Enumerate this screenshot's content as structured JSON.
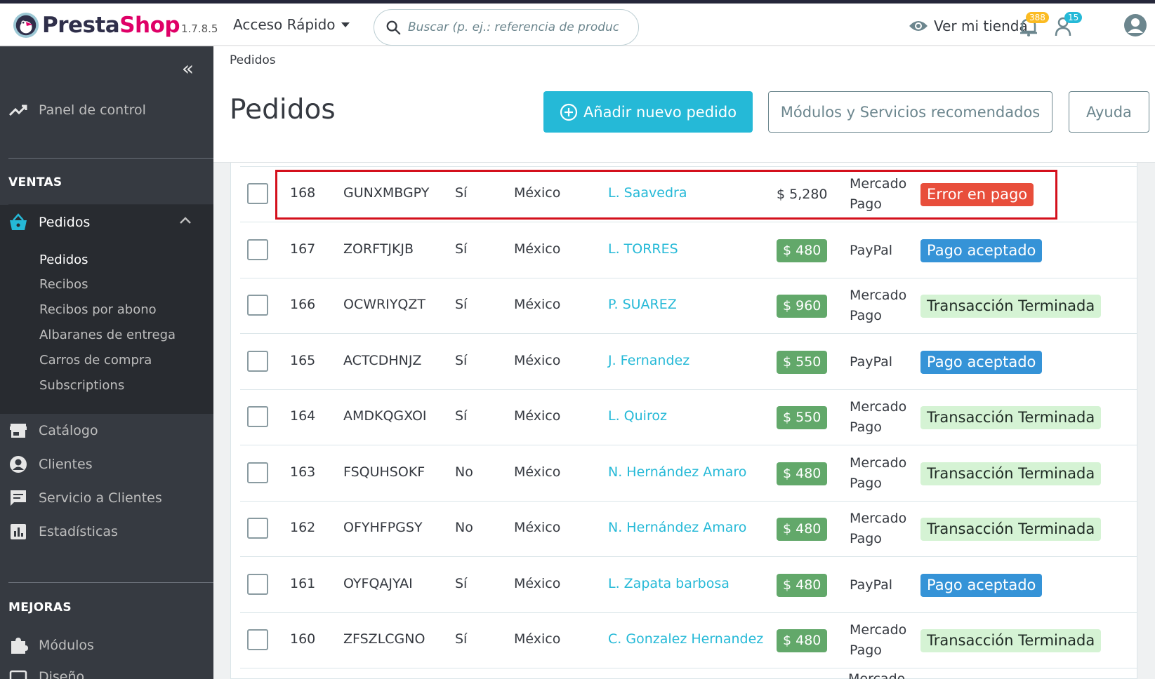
{
  "header": {
    "logo_part1": "Presta",
    "logo_part2": "Shop",
    "version": "1.7.8.5",
    "quick_access": "Acceso Rápido",
    "search_placeholder": "Buscar (p. ej.: referencia de producto, nombre de cliente…)",
    "view_store": "Ver mi tienda",
    "orders_badge": "388",
    "customers_badge": "15"
  },
  "sidebar": {
    "collapse_glyph": "«",
    "dashboard": "Panel de control",
    "section_sales": "VENTAS",
    "orders": "Pedidos",
    "orders_sub": [
      "Pedidos",
      "Recibos",
      "Recibos por abono",
      "Albaranes de entrega",
      "Carros de compra",
      "Subscriptions"
    ],
    "catalog": "Catálogo",
    "customers": "Clientes",
    "customer_service": "Servicio a Clientes",
    "stats": "Estadísticas",
    "section_improve": "MEJORAS",
    "modules": "Módulos",
    "design": "Diseño"
  },
  "page": {
    "breadcrumb": "Pedidos",
    "title": "Pedidos",
    "add_order": "Añadir nuevo pedido",
    "recommended": "Módulos y Servicios recomendados",
    "help": "Ayuda"
  },
  "orders": [
    {
      "id": "168",
      "ref": "GUNXMBGPY",
      "new": "Sí",
      "country": "México",
      "customer": "L. Saavedra",
      "total": "$ 5,280",
      "payment": [
        "Mercado",
        "Pago"
      ],
      "status": "Error en pago",
      "status_type": "error"
    },
    {
      "id": "167",
      "ref": "ZORFTJKJB",
      "new": "Sí",
      "country": "México",
      "customer": "L. TORRES",
      "total": "$ 480",
      "payment": [
        "PayPal"
      ],
      "status": "Pago aceptado",
      "status_type": "ok"
    },
    {
      "id": "166",
      "ref": "OCWRIYQZT",
      "new": "Sí",
      "country": "México",
      "customer": "P. SUAREZ",
      "total": "$ 960",
      "payment": [
        "Mercado",
        "Pago"
      ],
      "status": "Transacción Terminada",
      "status_type": "done"
    },
    {
      "id": "165",
      "ref": "ACTCDHNJZ",
      "new": "Sí",
      "country": "México",
      "customer": "J. Fernandez",
      "total": "$ 550",
      "payment": [
        "PayPal"
      ],
      "status": "Pago aceptado",
      "status_type": "ok"
    },
    {
      "id": "164",
      "ref": "AMDKQGXOI",
      "new": "Sí",
      "country": "México",
      "customer": "L. Quiroz",
      "total": "$ 550",
      "payment": [
        "Mercado",
        "Pago"
      ],
      "status": "Transacción Terminada",
      "status_type": "done"
    },
    {
      "id": "163",
      "ref": "FSQUHSOKF",
      "new": "No",
      "country": "México",
      "customer": "N. Hernández Amaro",
      "total": "$ 480",
      "payment": [
        "Mercado",
        "Pago"
      ],
      "status": "Transacción Terminada",
      "status_type": "done"
    },
    {
      "id": "162",
      "ref": "OFYHFPGSY",
      "new": "No",
      "country": "México",
      "customer": "N. Hernández Amaro",
      "total": "$ 480",
      "payment": [
        "Mercado",
        "Pago"
      ],
      "status": "Transacción Terminada",
      "status_type": "done"
    },
    {
      "id": "161",
      "ref": "OYFQAJYAI",
      "new": "Sí",
      "country": "México",
      "customer": "L. Zapata barbosa",
      "total": "$ 480",
      "payment": [
        "PayPal"
      ],
      "status": "Pago aceptado",
      "status_type": "ok"
    },
    {
      "id": "160",
      "ref": "ZFSZLCGNO",
      "new": "Sí",
      "country": "México",
      "customer": "C. Gonzalez Hernandez",
      "total": "$ 480",
      "payment": [
        "Mercado",
        "Pago"
      ],
      "status": "Transacción Terminada",
      "status_type": "done"
    }
  ],
  "partial_row_payment": "Mercado",
  "colors": {
    "accent": "#25b9d7",
    "sidebar": "#363a41",
    "error": "#e84e3b",
    "ok": "#3593d7",
    "done_bg": "#d5f3d4",
    "total_badge": "#62a86a",
    "highlight": "#d4101c"
  }
}
